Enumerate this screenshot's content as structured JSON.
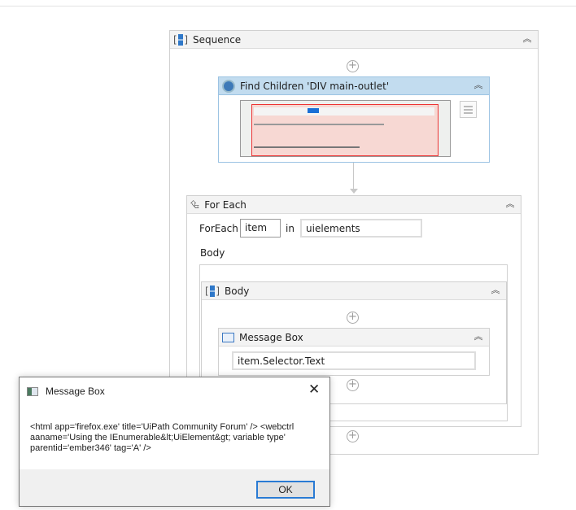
{
  "sequence": {
    "title": "Sequence"
  },
  "find_children": {
    "title": "Find Children 'DIV  main-outlet'"
  },
  "for_each": {
    "title": "For Each",
    "foreach_label": "ForEach",
    "item_value": "item",
    "in_label": "in",
    "collection_value": "uielements",
    "body_label": "Body"
  },
  "body_sequence": {
    "title": "Body"
  },
  "message_box_activity": {
    "title": "Message Box",
    "text_value": "item.Selector.Text"
  },
  "dialog": {
    "title": "Message Box",
    "message": "<html app='firefox.exe' title='UiPath Community Forum' /> <webctrl aaname='Using the IEnumerable&lt;UiElement&gt; variable type' parentid='ember346' tag='A' />",
    "ok_label": "OK"
  }
}
